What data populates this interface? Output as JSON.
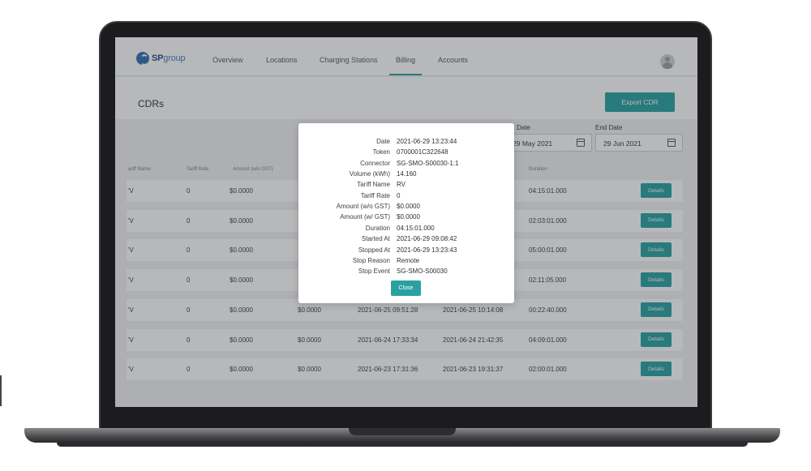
{
  "nav": {
    "logo_primary": "SP",
    "logo_secondary": "group",
    "links": [
      {
        "label": "Overview"
      },
      {
        "label": "Locations"
      },
      {
        "label": "Charging Stations"
      },
      {
        "label": "Billing"
      },
      {
        "label": "Accounts"
      }
    ],
    "active": "Billing"
  },
  "page": {
    "title": "CDRs",
    "export_label": "Export CDR",
    "start_date_label": "rt Date",
    "start_date_value": "29 May 2021",
    "end_date_label": "End Date",
    "end_date_value": "29 Jun 2021"
  },
  "table": {
    "headers": [
      "ariff Name",
      "Tariff Rate",
      "Amount (w/o GST)",
      "Duration"
    ],
    "details_label": "Details",
    "rows": [
      {
        "tariff_name": "'V",
        "tariff_rate": "0",
        "amount": "$0.0000",
        "amount_gst": "",
        "started": "",
        "stopped": "",
        "duration": "04:15:01.000"
      },
      {
        "tariff_name": "'V",
        "tariff_rate": "0",
        "amount": "$0.0000",
        "amount_gst": "",
        "started": "",
        "stopped": "",
        "duration": "02:03:01.000"
      },
      {
        "tariff_name": "'V",
        "tariff_rate": "0",
        "amount": "$0.0000",
        "amount_gst": "",
        "started": "",
        "stopped": "",
        "duration": "05:00:01.000"
      },
      {
        "tariff_name": "'V",
        "tariff_rate": "0",
        "amount": "$0.0000",
        "amount_gst": "",
        "started": "",
        "stopped": "",
        "duration": "02:11:05.000"
      },
      {
        "tariff_name": "'V",
        "tariff_rate": "0",
        "amount": "$0.0000",
        "amount_gst": "$0.0000",
        "started": "2021-06-25 09:51:28",
        "stopped": "2021-06-25 10:14:08",
        "duration": "00:22:40.000"
      },
      {
        "tariff_name": "'V",
        "tariff_rate": "0",
        "amount": "$0.0000",
        "amount_gst": "$0.0000",
        "started": "2021-06-24 17:33:34",
        "stopped": "2021-06-24 21:42:35",
        "duration": "04:09:01.000"
      },
      {
        "tariff_name": "'V",
        "tariff_rate": "0",
        "amount": "$0.0000",
        "amount_gst": "$0.0000",
        "started": "2021-06-23 17:31:36",
        "stopped": "2021-06-23 19:31:37",
        "duration": "02:00:01.000"
      }
    ]
  },
  "modal": {
    "fields": [
      {
        "label": "Date",
        "value": "2021-06-29 13:23:44"
      },
      {
        "label": "Token",
        "value": "0700001C322648"
      },
      {
        "label": "Connector",
        "value": "SG-SMO-S00030-1:1"
      },
      {
        "label": "Volume (kWh)",
        "value": "14.160"
      },
      {
        "label": "Tariff Name",
        "value": "RV"
      },
      {
        "label": "Tariff Rate",
        "value": "0"
      },
      {
        "label": "Amount (w/o GST)",
        "value": "$0.0000"
      },
      {
        "label": "Amount (w/ GST)",
        "value": "$0.0000"
      },
      {
        "label": "Duration",
        "value": "04:15:01.000"
      },
      {
        "label": "Started At",
        "value": "2021-06-29 09:08:42"
      },
      {
        "label": "Stopped At",
        "value": "2021-06-29 13:23:43"
      },
      {
        "label": "Stop Reason",
        "value": "Remote"
      },
      {
        "label": "Stop Event",
        "value": "SG-SMO-S00030"
      }
    ],
    "close_label": "Close"
  },
  "colors": {
    "accent": "#2aa1a1",
    "brand": "#2f6fb3"
  }
}
